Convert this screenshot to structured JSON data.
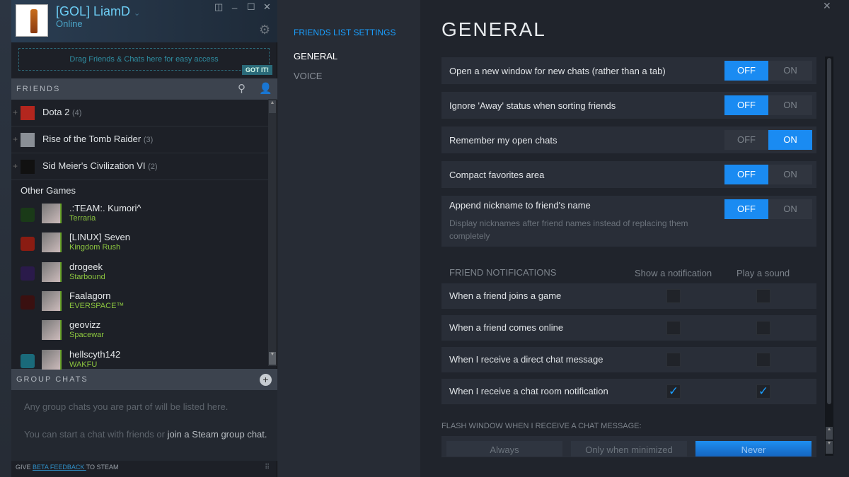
{
  "user": {
    "name": "[GOL] LiamD",
    "status": "Online"
  },
  "window": {
    "popout": "◫",
    "minimize": "_",
    "maximize": "☐",
    "close": "✕"
  },
  "drag": {
    "text": "Drag Friends & Chats here for easy access",
    "got_it": "GOT IT!"
  },
  "friends": {
    "header": "FRIENDS",
    "groups": [
      {
        "name": "Dota 2",
        "count": "(4)",
        "color": "#b3261e"
      },
      {
        "name": "Rise of the Tomb Raider",
        "count": "(3)",
        "color": "#8a8f96"
      },
      {
        "name": "Sid Meier's Civilization VI",
        "count": "(2)",
        "color": "#111"
      }
    ],
    "other_label": "Other Games",
    "list": [
      {
        "name": ".:TEAM:. Kumori^",
        "game": "Terraria",
        "color": "#1a3a18"
      },
      {
        "name": "[LINUX] Seven",
        "game": "Kingdom Rush",
        "color": "#8a1c12"
      },
      {
        "name": "drogeek",
        "game": "Starbound",
        "color": "#2a1a4a"
      },
      {
        "name": "Faalagorn",
        "game": "EVERSPACE™",
        "color": "#3a1010"
      },
      {
        "name": "geovizz",
        "game": "Spacewar",
        "color": ""
      },
      {
        "name": "hellscyth142",
        "game": "WAKFU",
        "color": "#1a6a7a"
      }
    ]
  },
  "group_chats": {
    "header": "GROUP CHATS",
    "empty1": "Any group chats you are part of will be listed here.",
    "empty2a": "You can start a chat with friends or ",
    "empty2link": "join a Steam group chat."
  },
  "footer": {
    "pre": "GIVE ",
    "link": "BETA FEEDBACK ",
    "post": "TO STEAM"
  },
  "nav": {
    "heading": "FRIENDS LIST SETTINGS",
    "items": [
      "GENERAL",
      "VOICE"
    ]
  },
  "settings": {
    "title": "GENERAL",
    "off": "OFF",
    "on": "ON",
    "toggles": [
      {
        "label": "Open a new window for new chats (rather than a tab)",
        "value": "OFF"
      },
      {
        "label": "Ignore 'Away' status when sorting friends",
        "value": "OFF"
      },
      {
        "label": "Remember my open chats",
        "value": "ON"
      },
      {
        "label": "Compact favorites area",
        "value": "OFF"
      },
      {
        "label": "Append nickname to friend's name",
        "sub": "Display nicknames after friend names instead of replacing them completely",
        "value": "OFF"
      }
    ],
    "notifications": {
      "header": "FRIEND NOTIFICATIONS",
      "col1": "Show a notification",
      "col2": "Play a sound",
      "rows": [
        {
          "label": "When a friend joins a game",
          "show": false,
          "sound": false
        },
        {
          "label": "When a friend comes online",
          "show": false,
          "sound": false
        },
        {
          "label": "When I receive a direct chat message",
          "show": false,
          "sound": false
        },
        {
          "label": "When I receive a chat room notification",
          "show": true,
          "sound": true
        }
      ]
    },
    "flash": {
      "label": "FLASH WINDOW WHEN I RECEIVE A CHAT MESSAGE:",
      "options": [
        "Always",
        "Only when minimized",
        "Never"
      ],
      "selected": "Never"
    }
  }
}
